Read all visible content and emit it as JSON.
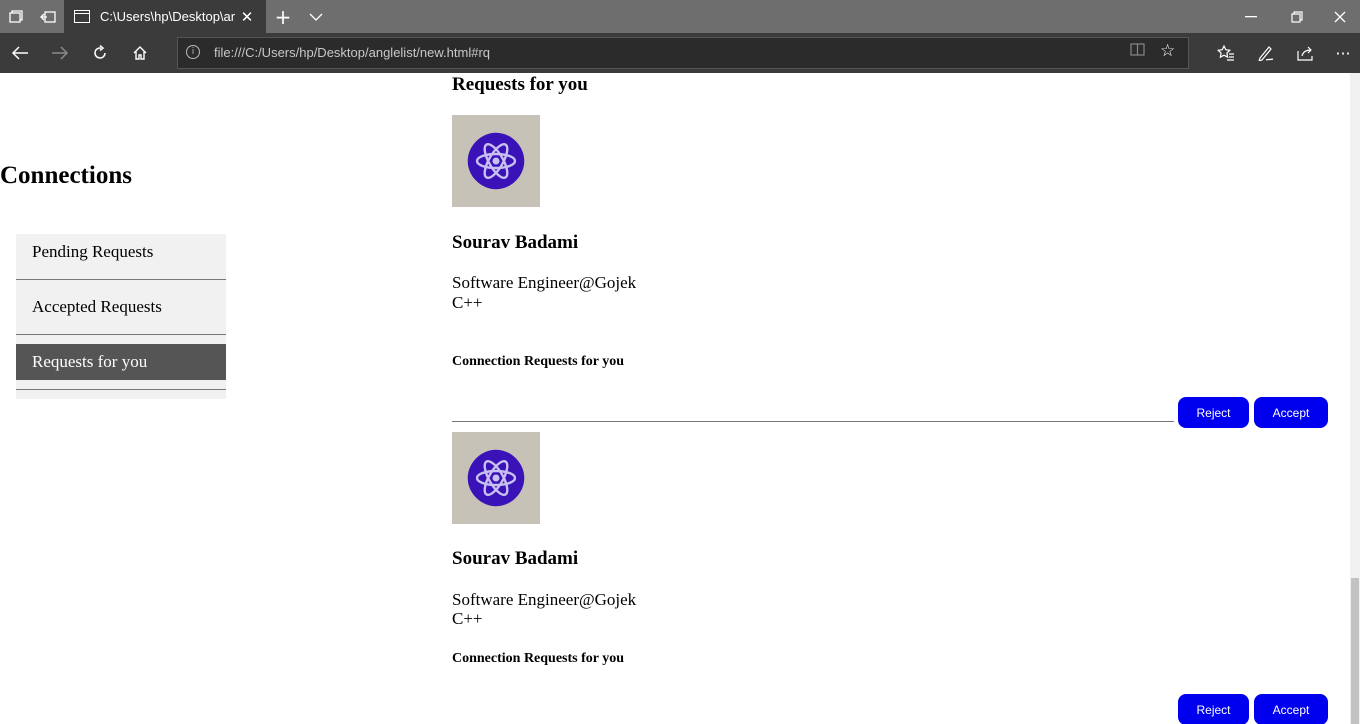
{
  "browser": {
    "tab_title": "C:\\Users\\hp\\Desktop\\ar",
    "url": "file:///C:/Users/hp/Desktop/anglelist/new.html#rq",
    "icons": [
      "tab-overview-icon",
      "set-tabs-aside-icon",
      "page-icon",
      "close-tab-icon",
      "new-tab-icon",
      "tab-dropdown-icon",
      "minimize-icon",
      "restore-icon",
      "close-window-icon",
      "back-icon",
      "forward-icon",
      "refresh-icon",
      "home-icon",
      "site-info-icon",
      "reading-view-icon",
      "favorite-star-icon",
      "favorites-list-icon",
      "pen-icon",
      "share-icon",
      "more-icon"
    ]
  },
  "sidebar": {
    "title": "Connections",
    "items": [
      {
        "label": "Pending Requests",
        "active": false
      },
      {
        "label": "Accepted Requests",
        "active": false
      },
      {
        "label": "Requests for you",
        "active": true
      }
    ],
    "active_bg": "#555555"
  },
  "main": {
    "section_title": "Requests for you",
    "requests": [
      {
        "name": "Sourav Badami",
        "role": "Software Engineer@Gojek",
        "skill": "C++",
        "note": "Connection Requests for you",
        "reject_label": "Reject",
        "accept_label": "Accept"
      },
      {
        "name": "Sourav Badami",
        "role": "Software Engineer@Gojek",
        "skill": "C++",
        "note": "Connection Requests for you",
        "reject_label": "Reject",
        "accept_label": "Accept"
      }
    ],
    "button_color": "#0000ee"
  }
}
